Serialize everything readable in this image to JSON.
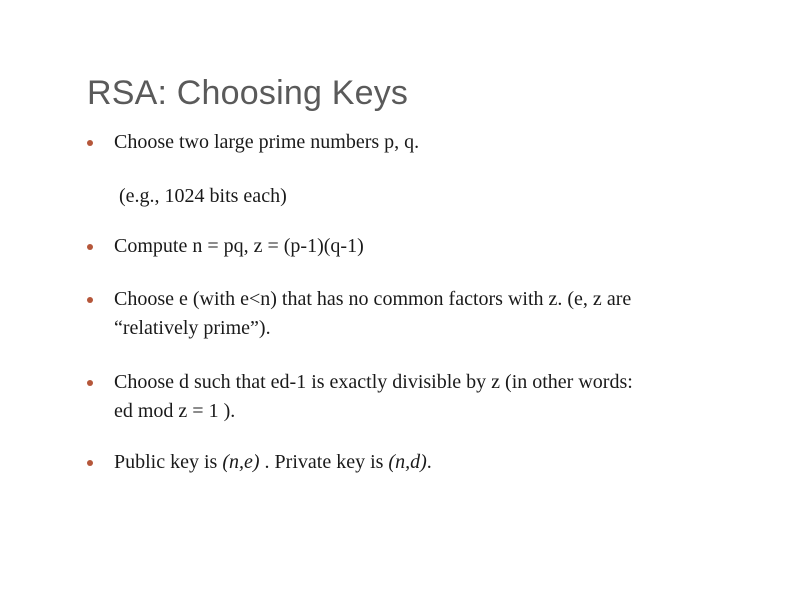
{
  "slide": {
    "title": "RSA: Choosing Keys",
    "bullet_color": "#b5573a",
    "title_color": "#5a5a5a",
    "bullets": [
      {
        "text": "Choose two large prime numbers p, q.",
        "sub": "(e.g., 1024 bits each)"
      },
      {
        "text": "Compute n = pq,  z = (p-1)(q-1)"
      },
      {
        "line1": "Choose e (with e<n) that has no common factors with z. (e, z are",
        "line2": "“relatively prime”)."
      },
      {
        "line1": "Choose d such that ed-1 is  exactly divisible by z (in other words:",
        "line2": "ed mod z  = 1 )."
      },
      {
        "prefix": "Public key is ",
        "public_key": "(n,e)",
        "middle": " .  Private key is ",
        "private_key": "(n,d)",
        "suffix": "."
      }
    ]
  }
}
